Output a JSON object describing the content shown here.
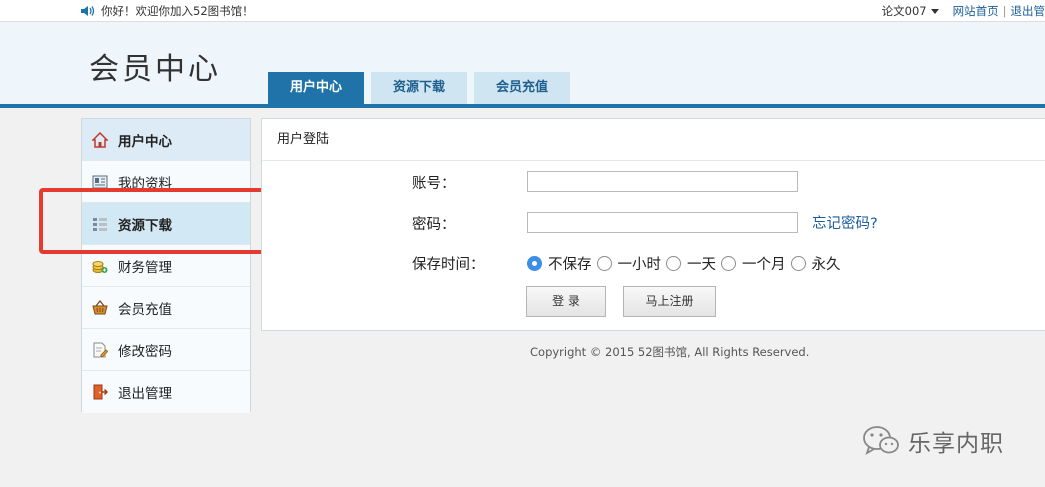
{
  "topbar": {
    "welcome": "你好！欢迎你加入52图书馆！",
    "user": "论文007",
    "links": [
      "网站首页",
      "退出管"
    ]
  },
  "header": {
    "logo": "会员中心",
    "tabs": [
      {
        "label": "用户中心",
        "active": true
      },
      {
        "label": "资源下载",
        "active": false
      },
      {
        "label": "会员充值",
        "active": false
      }
    ]
  },
  "sidebar": {
    "items": [
      {
        "label": "用户中心",
        "icon": "home-icon"
      },
      {
        "label": "我的资料",
        "icon": "profile-card-icon"
      },
      {
        "label": "资源下载",
        "icon": "list-icon"
      },
      {
        "label": "财务管理",
        "icon": "coins-icon"
      },
      {
        "label": "会员充值",
        "icon": "basket-icon"
      },
      {
        "label": "修改密码",
        "icon": "edit-document-icon"
      },
      {
        "label": "退出管理",
        "icon": "exit-door-icon"
      }
    ]
  },
  "login": {
    "title": "用户登陆",
    "account_label": "账号：",
    "password_label": "密码：",
    "forgot": "忘记密码?",
    "save_label": "保存时间：",
    "save_options": [
      "不保存",
      "一小时",
      "一天",
      "一个月",
      "永久"
    ],
    "save_selected": "不保存",
    "login_button": "登 录",
    "register_button": "马上注册"
  },
  "footer": {
    "copyright": "Copyright © 2015 52图书馆, All Rights Reserved."
  },
  "watermark": {
    "text": "乐享内职"
  },
  "colors": {
    "accent": "#1f73a8",
    "highlight": "#e53a2f"
  }
}
